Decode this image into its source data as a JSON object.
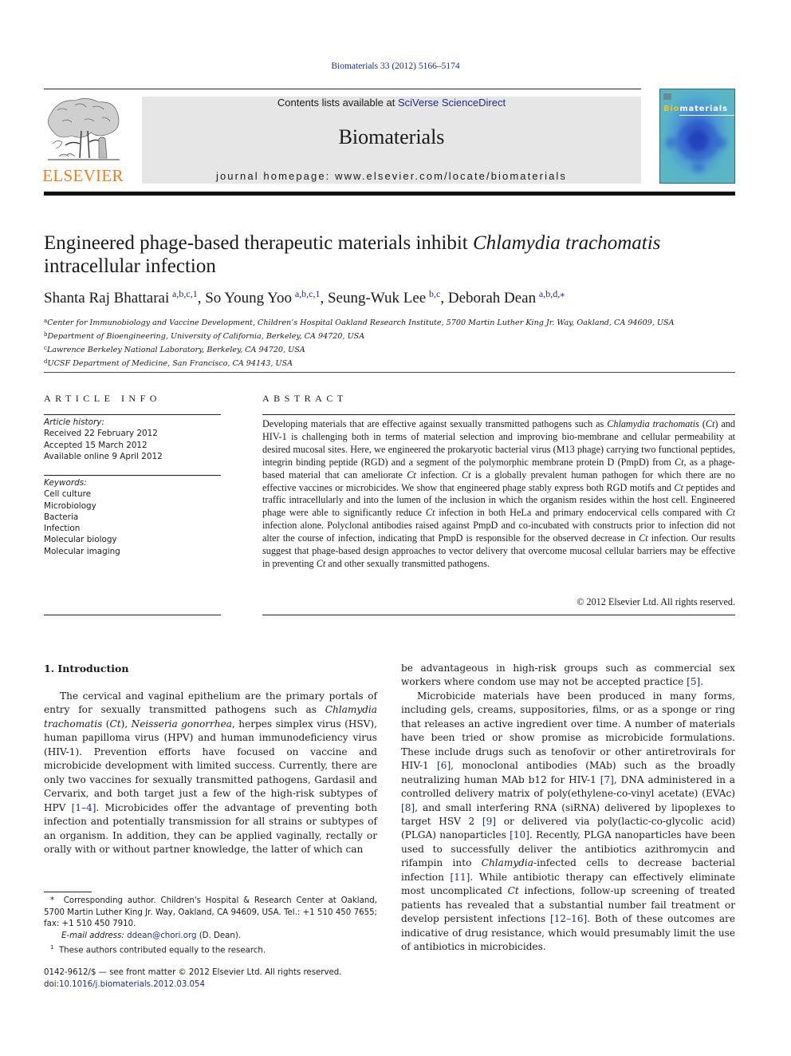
{
  "header": {
    "journal_ref": "Biomaterials 33 (2012) 5166–5174",
    "contents_prefix": "Contents lists available at ",
    "contents_link": "SciVerse ScienceDirect",
    "journal_name": "Biomaterials",
    "homepage": "journal homepage: www.elsevier.com/locate/biomaterials",
    "publisher_logo_text": "ELSEVIER",
    "cover": {
      "title_highlight": "Bio",
      "title_rest": "materials"
    },
    "colors": {
      "link": "#1f2a8a",
      "elsevier_orange": "#f07d1a",
      "banner_bg": "#e6e6e6"
    }
  },
  "article": {
    "title_part1": "Engineered phage-based therapeutic materials inhibit ",
    "title_italic": "Chlamydia trachomatis",
    "title_part2": "intracellular infection",
    "authors": [
      {
        "name": "Shanta Raj Bhattarai",
        "sup": "a,b,c,1",
        "sep": ", "
      },
      {
        "name": "So Young Yoo",
        "sup": "a,b,c,1",
        "sep": ", "
      },
      {
        "name": "Seung-Wuk Lee",
        "sup": "b,c",
        "sep": ", "
      },
      {
        "name": "Deborah Dean",
        "sup": "a,b,d,⁎",
        "sep": ""
      }
    ],
    "affiliations": [
      {
        "key": "a",
        "text": "Center for Immunobiology and Vaccine Development, Children’s Hospital Oakland Research Institute, 5700 Martin Luther King Jr. Way, Oakland, CA 94609, USA"
      },
      {
        "key": "b",
        "text": "Department of Bioengineering, University of California, Berkeley, CA 94720, USA"
      },
      {
        "key": "c",
        "text": "Lawrence Berkeley National Laboratory, Berkeley, CA 94720, USA"
      },
      {
        "key": "d",
        "text": "UCSF Department of Medicine, San Francisco, CA 94143, USA"
      }
    ]
  },
  "article_info": {
    "heading": "ARTICLE INFO",
    "history_label": "Article history:",
    "history": [
      "Received 22 February 2012",
      "Accepted 15 March 2012",
      "Available online 9 April 2012"
    ],
    "keywords_label": "Keywords:",
    "keywords": [
      "Cell culture",
      "Microbiology",
      "Bacteria",
      "Infection",
      "Molecular biology",
      "Molecular imaging"
    ]
  },
  "abstract": {
    "heading": "ABSTRACT",
    "segments": [
      {
        "t": "Developing materials that are effective against sexually transmitted pathogens such as "
      },
      {
        "t": "Chlamydia trachomatis",
        "i": true
      },
      {
        "t": " ("
      },
      {
        "t": "Ct",
        "i": true
      },
      {
        "t": ") and HIV-1 is challenging both in terms of material selection and improving bio-membrane and cellular permeability at desired mucosal sites. Here, we engineered the prokaryotic bacterial virus (M13 phage) carrying two functional peptides, integrin binding peptide (RGD) and a segment of the polymorphic membrane protein D (PmpD) from "
      },
      {
        "t": "Ct",
        "i": true
      },
      {
        "t": ", as a phage-based material that can ameliorate "
      },
      {
        "t": "Ct",
        "i": true
      },
      {
        "t": " infection. "
      },
      {
        "t": "Ct",
        "i": true
      },
      {
        "t": " is a globally prevalent human pathogen for which there are no effective vaccines or microbicides. We show that engineered phage stably express both RGD motifs and "
      },
      {
        "t": "Ct",
        "i": true
      },
      {
        "t": " peptides and traffic intracellularly and into the lumen of the inclusion in which the organism resides within the host cell. Engineered phage were able to significantly reduce "
      },
      {
        "t": "Ct",
        "i": true
      },
      {
        "t": " infection in both HeLa and primary endocervical cells compared with "
      },
      {
        "t": "Ct",
        "i": true
      },
      {
        "t": " infection alone. Polyclonal antibodies raised against PmpD and co-incubated with constructs prior to infection did not alter the course of infection, indicating that PmpD is responsible for the observed decrease in "
      },
      {
        "t": "Ct",
        "i": true
      },
      {
        "t": " infection. Our results suggest that phage-based design approaches to vector delivery that overcome mucosal cellular barriers may be effective in preventing "
      },
      {
        "t": "Ct",
        "i": true
      },
      {
        "t": " and other sexually transmitted pathogens."
      }
    ],
    "copyright": "© 2012 Elsevier Ltd. All rights reserved."
  },
  "body": {
    "section_heading": "1.  Introduction",
    "left_paragraph": [
      {
        "t": "The cervical and vaginal epithelium are the primary portals of entry for sexually transmitted pathogens such as "
      },
      {
        "t": "Chlamydia trachomatis",
        "i": true
      },
      {
        "t": " ("
      },
      {
        "t": "Ct",
        "i": true
      },
      {
        "t": "), "
      },
      {
        "t": "Neisseria gonorrhea",
        "i": true
      },
      {
        "t": ", herpes simplex virus (HSV), human papilloma virus (HPV) and human immunodeficiency virus (HIV-1). Prevention efforts have focused on vaccine and microbicide development with limited success. Currently, there are only two vaccines for sexually transmitted pathogens, Gardasil and Cervarix, and both target just a few of the high-risk subtypes of HPV "
      },
      {
        "t": "[1–4]",
        "ref": true
      },
      {
        "t": ". Microbicides offer the advantage of preventing both infection and potentially transmission for all strains or subtypes of an organism. In addition, they can be applied vaginally, rectally or orally with or without partner knowledge, the latter of which can"
      }
    ],
    "right_paragraph_1": [
      {
        "t": "be advantageous in high-risk groups such as commercial sex workers where condom use may not be accepted practice "
      },
      {
        "t": "[5]",
        "ref": true
      },
      {
        "t": "."
      }
    ],
    "right_paragraph_2": [
      {
        "t": "Microbicide materials have been produced in many forms, including gels, creams, suppositories, films, or as a sponge or ring that releases an active ingredient over time. A number of materials have been tried or show promise as microbicide formulations. These include drugs such as tenofovir or other antiretrovirals for HIV-1 "
      },
      {
        "t": "[6]",
        "ref": true
      },
      {
        "t": ", monoclonal antibodies (MAb) such as the broadly neutralizing human MAb b12 for HIV-1 "
      },
      {
        "t": "[7]",
        "ref": true
      },
      {
        "t": ", DNA administered in a controlled delivery matrix of poly(ethylene-co-vinyl acetate) (EVAc) "
      },
      {
        "t": "[8]",
        "ref": true
      },
      {
        "t": ", and small interfering RNA (siRNA) delivered by lipoplexes to target HSV 2 "
      },
      {
        "t": "[9]",
        "ref": true
      },
      {
        "t": " or delivered via poly(lactic-co-glycolic acid) (PLGA) nanoparticles "
      },
      {
        "t": "[10]",
        "ref": true
      },
      {
        "t": ". Recently, PLGA nanoparticles have been used to successfully deliver the antibiotics azithromycin and rifampin into "
      },
      {
        "t": "Chlamydia",
        "i": true
      },
      {
        "t": "-infected cells to decrease bacterial infection "
      },
      {
        "t": "[11]",
        "ref": true
      },
      {
        "t": ". While antibiotic therapy can effectively eliminate most uncomplicated "
      },
      {
        "t": "Ct",
        "i": true
      },
      {
        "t": " infections, follow-up screening of treated patients has revealed that a substantial number fail treatment or develop persistent infections "
      },
      {
        "t": "[12–16]",
        "ref": true
      },
      {
        "t": ". Both of these outcomes are indicative of drug resistance, which would presumably limit the use of antibiotics in microbicides."
      }
    ]
  },
  "footnotes": {
    "corresponding_marker": "*",
    "corresponding": "Corresponding author. Children's Hospital & Research Center at Oakland, 5700 Martin Luther King Jr. Way, Oakland, CA 94609, USA. Tel.: +1 510 450 7655; fax: +1 510 450 7910.",
    "email_label": "E-mail address:",
    "email": "ddean@chori.org",
    "email_suffix": " (D. Dean).",
    "equal_marker": "1",
    "equal": "These authors contributed equally to the research."
  },
  "front_matter": {
    "issn_line": "0142-9612/$ — see front matter © 2012 Elsevier Ltd. All rights reserved.",
    "doi_prefix": "doi:",
    "doi": "10.1016/j.biomaterials.2012.03.054"
  }
}
